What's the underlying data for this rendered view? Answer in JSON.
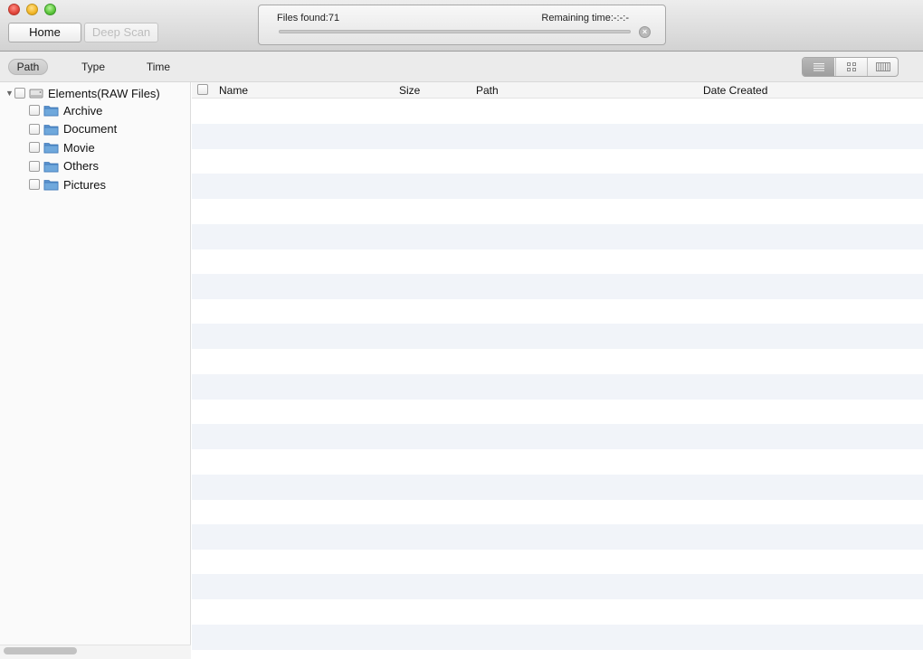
{
  "toolbar": {
    "home_label": "Home",
    "deep_scan_label": "Deep Scan",
    "files_found": "Files found:71",
    "remaining_time": "Remaining time:-:-:-",
    "progress_fraction": 0.0,
    "stop_icon": "stop-circle-icon"
  },
  "filters": {
    "path_label": "Path",
    "type_label": "Type",
    "time_label": "Time",
    "active": "Path"
  },
  "view_switcher": {
    "items": [
      "list-view-icon",
      "grid-view-icon",
      "filmstrip-view-icon"
    ],
    "active": "list-view-icon"
  },
  "tree": {
    "root_label": "Elements(RAW Files)",
    "root_icon": "drive-icon",
    "children": [
      {
        "label": "Archive",
        "icon": "folder-icon"
      },
      {
        "label": "Document",
        "icon": "folder-icon"
      },
      {
        "label": "Movie",
        "icon": "folder-icon"
      },
      {
        "label": "Others",
        "icon": "folder-icon"
      },
      {
        "label": "Pictures",
        "icon": "folder-icon"
      }
    ]
  },
  "table": {
    "columns": [
      "Name",
      "Size",
      "Path",
      "Date Created"
    ],
    "rows": []
  },
  "colors": {
    "folder": "#6fa8dc",
    "alt_row": "#f1f4f9"
  }
}
